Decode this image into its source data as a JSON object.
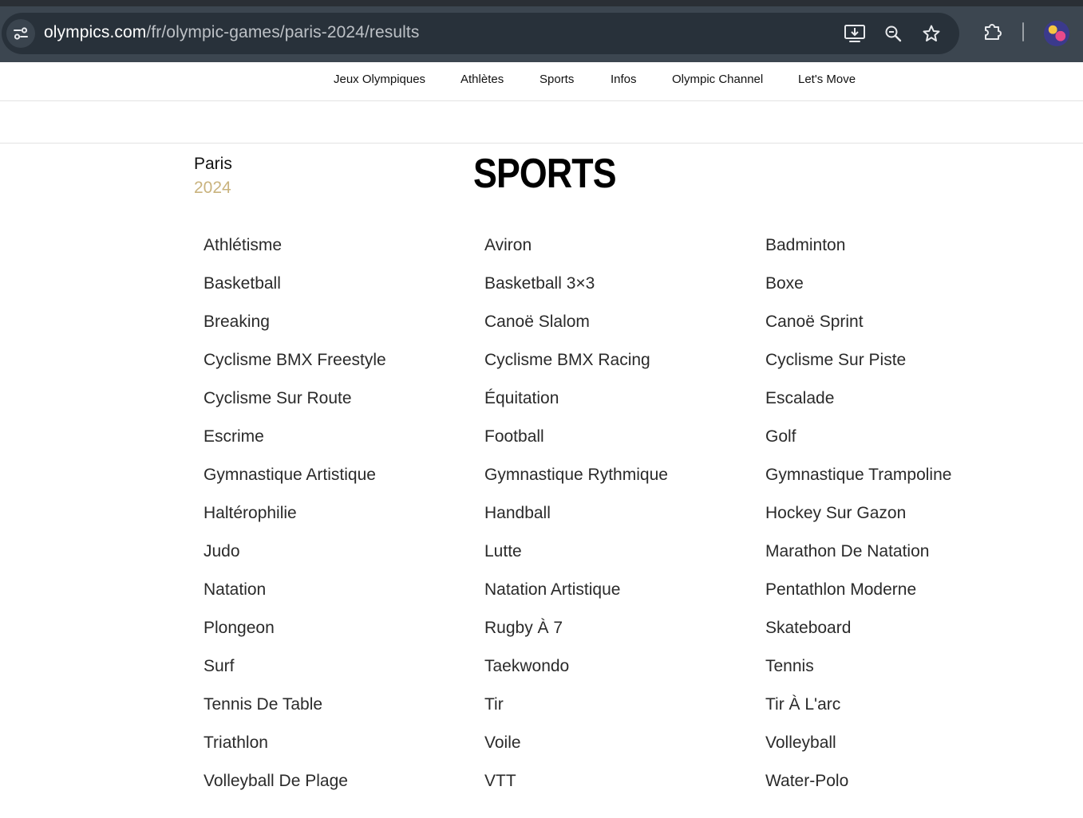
{
  "browser": {
    "url_domain": "olympics.com",
    "url_path": "/fr/olympic-games/paris-2024/results"
  },
  "site_nav": {
    "items": [
      "Jeux Olympiques",
      "Athlètes",
      "Sports",
      "Infos",
      "Olympic Channel",
      "Let's Move"
    ]
  },
  "event": {
    "city": "Paris",
    "year": "2024",
    "year_color": "#c9b37e"
  },
  "page": {
    "title": "SPORTS"
  },
  "sports": {
    "columns": [
      [
        "Athlétisme",
        "Basketball",
        "Breaking",
        "Cyclisme BMX Freestyle",
        "Cyclisme Sur Route",
        "Escrime",
        "Gymnastique Artistique",
        "Haltérophilie",
        "Judo",
        "Natation",
        "Plongeon",
        "Surf",
        "Tennis De Table",
        "Triathlon",
        "Volleyball De Plage"
      ],
      [
        "Aviron",
        "Basketball 3×3",
        "Canoë Slalom",
        "Cyclisme BMX Racing",
        "Équitation",
        "Football",
        "Gymnastique Rythmique",
        "Handball",
        "Lutte",
        "Natation Artistique",
        "Rugby À 7",
        "Taekwondo",
        "Tir",
        "Voile",
        "VTT"
      ],
      [
        "Badminton",
        "Boxe",
        "Canoë Sprint",
        "Cyclisme Sur Piste",
        "Escalade",
        "Golf",
        "Gymnastique Trampoline",
        "Hockey Sur Gazon",
        "Marathon De Natation",
        "Pentathlon Moderne",
        "Skateboard",
        "Tennis",
        "Tir À L'arc",
        "Volleyball",
        "Water-Polo"
      ]
    ]
  },
  "icons": {
    "site_info": "site-info-icon",
    "install": "install-app-icon",
    "zoom": "zoom-icon",
    "bookmark": "star-icon",
    "extensions": "puzzle-icon",
    "profile": "avatar"
  }
}
